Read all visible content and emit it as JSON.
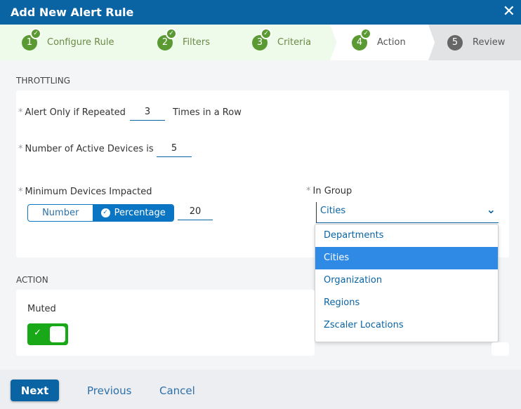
{
  "header": {
    "title": "Add New Alert Rule",
    "close_icon": "close-icon"
  },
  "steps": [
    {
      "num": "1",
      "label": "Configure Rule",
      "done": true
    },
    {
      "num": "2",
      "label": "Filters",
      "done": true
    },
    {
      "num": "3",
      "label": "Criteria",
      "done": true
    },
    {
      "num": "4",
      "label": "Action",
      "done": true,
      "active": true
    },
    {
      "num": "5",
      "label": "Review",
      "done": false
    }
  ],
  "throttling": {
    "title": "THROTTLING",
    "repeat_label": "Alert Only if Repeated",
    "repeat_value": "3",
    "repeat_suffix": "Times in a Row",
    "active_label": "Number of Active Devices is",
    "active_value": "5",
    "min_label": "Minimum Devices Impacted",
    "seg_number": "Number",
    "seg_percentage": "Percentage",
    "min_value": "20",
    "group_label": "In Group",
    "group_value": "Cities",
    "group_options": [
      "Departments",
      "Cities",
      "Organization",
      "Regions",
      "Zscaler Locations"
    ]
  },
  "action": {
    "title": "ACTION",
    "muted_label": "Muted",
    "muted": true
  },
  "footer": {
    "next": "Next",
    "previous": "Previous",
    "cancel": "Cancel"
  },
  "colors": {
    "primary": "#0a64a4",
    "step_done": "#5b9a33",
    "toggle_on": "#18a818",
    "selected_option": "#2f8ae6"
  }
}
